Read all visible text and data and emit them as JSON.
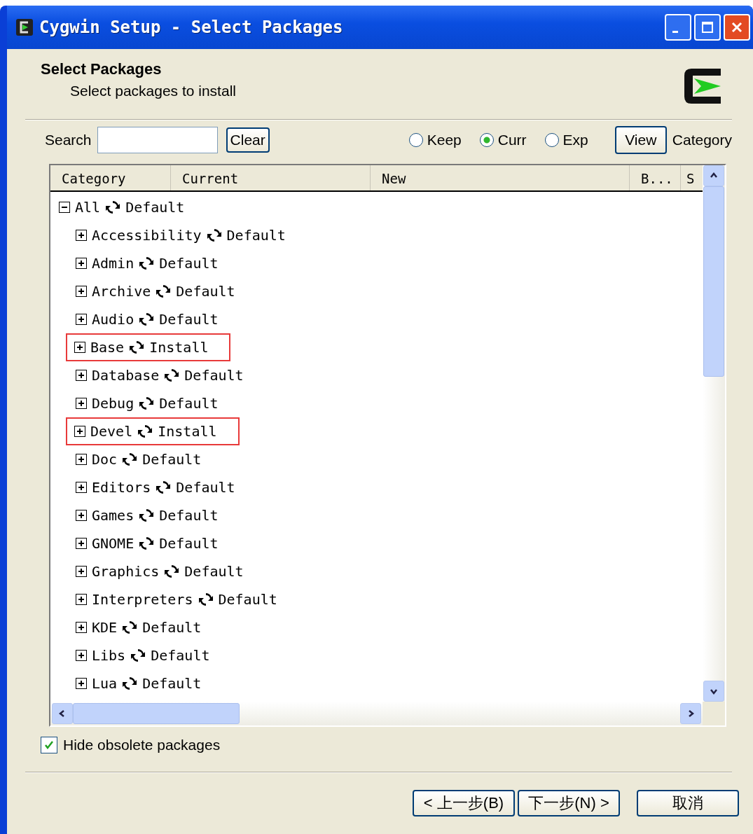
{
  "window": {
    "title": "Cygwin Setup - Select Packages"
  },
  "header": {
    "title": "Select Packages",
    "subtitle": "Select packages to install"
  },
  "search": {
    "label": "Search",
    "clear_button": "Clear"
  },
  "view_options": [
    {
      "label": "Keep",
      "selected": false
    },
    {
      "label": "Curr",
      "selected": true
    },
    {
      "label": "Exp",
      "selected": false
    }
  ],
  "view_button": "View",
  "view_mode": "Category",
  "table": {
    "columns": [
      "Category",
      "Current",
      "New",
      "B...",
      "S"
    ],
    "tree": [
      {
        "name": "All",
        "action": "Default",
        "expanded": true,
        "highlighted": false,
        "children": [
          {
            "name": "Accessibility",
            "action": "Default",
            "expanded": false,
            "highlighted": false
          },
          {
            "name": "Admin",
            "action": "Default",
            "expanded": false,
            "highlighted": false
          },
          {
            "name": "Archive",
            "action": "Default",
            "expanded": false,
            "highlighted": false
          },
          {
            "name": "Audio",
            "action": "Default",
            "expanded": false,
            "highlighted": false
          },
          {
            "name": "Base",
            "action": "Install",
            "expanded": false,
            "highlighted": true
          },
          {
            "name": "Database",
            "action": "Default",
            "expanded": false,
            "highlighted": false
          },
          {
            "name": "Debug",
            "action": "Default",
            "expanded": false,
            "highlighted": false
          },
          {
            "name": "Devel",
            "action": "Install",
            "expanded": false,
            "highlighted": true
          },
          {
            "name": "Doc",
            "action": "Default",
            "expanded": false,
            "highlighted": false
          },
          {
            "name": "Editors",
            "action": "Default",
            "expanded": false,
            "highlighted": false
          },
          {
            "name": "Games",
            "action": "Default",
            "expanded": false,
            "highlighted": false
          },
          {
            "name": "GNOME",
            "action": "Default",
            "expanded": false,
            "highlighted": false
          },
          {
            "name": "Graphics",
            "action": "Default",
            "expanded": false,
            "highlighted": false
          },
          {
            "name": "Interpreters",
            "action": "Default",
            "expanded": false,
            "highlighted": false
          },
          {
            "name": "KDE",
            "action": "Default",
            "expanded": false,
            "highlighted": false
          },
          {
            "name": "Libs",
            "action": "Default",
            "expanded": false,
            "highlighted": false
          },
          {
            "name": "Lua",
            "action": "Default",
            "expanded": false,
            "highlighted": false
          }
        ]
      }
    ]
  },
  "hide_obsolete": {
    "label": "Hide obsolete packages",
    "checked": true
  },
  "buttons": [
    "< 上一步(B)",
    "下一步(N) >",
    "取消"
  ]
}
